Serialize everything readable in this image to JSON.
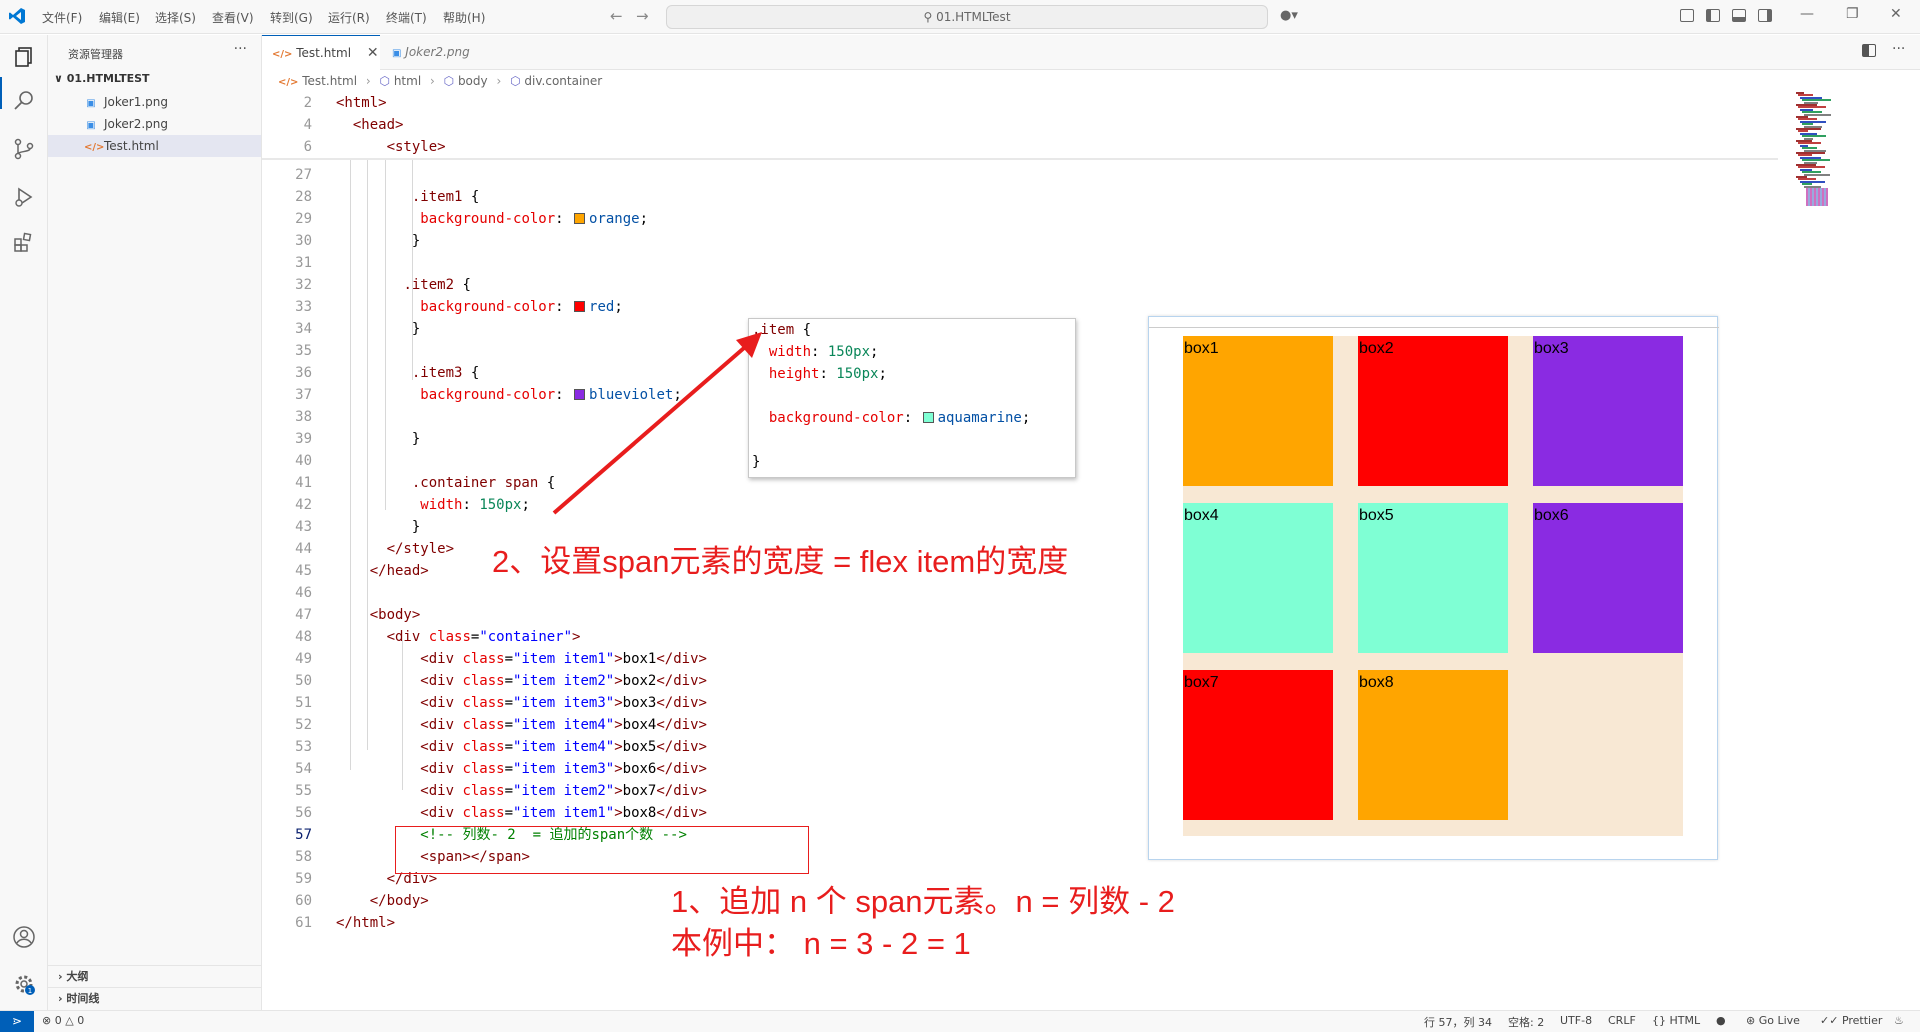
{
  "menu": [
    "文件(F)",
    "编辑(E)",
    "选择(S)",
    "查看(V)",
    "转到(G)",
    "运行(R)",
    "终端(T)",
    "帮助(H)"
  ],
  "search_text": "01.HTMLTest",
  "sidebar": {
    "title": "资源管理器",
    "folder": "01.HTMLTEST",
    "files": [
      "Joker1.png",
      "Joker2.png",
      "Test.html"
    ],
    "outline": "大纲",
    "timeline": "时间线"
  },
  "tabs": [
    {
      "label": "Test.html",
      "active": true
    },
    {
      "label": "Joker2.png",
      "active": false
    }
  ],
  "breadcrumb": [
    "Test.html",
    "html",
    "body",
    "div.container"
  ],
  "code_lines": [
    {
      "n": "2",
      "segs": [
        {
          "c": "tag",
          "t": "<html>"
        }
      ]
    },
    {
      "n": "4",
      "segs": [
        {
          "c": "txt",
          "t": "  "
        },
        {
          "c": "tag",
          "t": "<head>"
        }
      ]
    },
    {
      "n": "6",
      "segs": [
        {
          "c": "txt",
          "t": "      "
        },
        {
          "c": "tag",
          "t": "<style>"
        }
      ]
    },
    {
      "n": "27",
      "segs": []
    },
    {
      "n": "28",
      "segs": [
        {
          "c": "txt",
          "t": "         "
        },
        {
          "c": "sel",
          "t": ".item1"
        },
        {
          "c": "punc",
          "t": " {"
        }
      ]
    },
    {
      "n": "29",
      "segs": [
        {
          "c": "txt",
          "t": "          "
        },
        {
          "c": "prop",
          "t": "background-color"
        },
        {
          "c": "punc",
          "t": ": "
        },
        {
          "c": "swatch",
          "t": "#ffa500"
        },
        {
          "c": "val",
          "t": "orange"
        },
        {
          "c": "punc",
          "t": ";"
        }
      ]
    },
    {
      "n": "30",
      "segs": [
        {
          "c": "txt",
          "t": "         "
        },
        {
          "c": "punc",
          "t": "}"
        }
      ]
    },
    {
      "n": "31",
      "segs": []
    },
    {
      "n": "32",
      "segs": [
        {
          "c": "txt",
          "t": "        "
        },
        {
          "c": "sel",
          "t": ".item2"
        },
        {
          "c": "punc",
          "t": " {"
        }
      ]
    },
    {
      "n": "33",
      "segs": [
        {
          "c": "txt",
          "t": "          "
        },
        {
          "c": "prop",
          "t": "background-color"
        },
        {
          "c": "punc",
          "t": ": "
        },
        {
          "c": "swatch",
          "t": "#ff0000"
        },
        {
          "c": "val",
          "t": "red"
        },
        {
          "c": "punc",
          "t": ";"
        }
      ]
    },
    {
      "n": "34",
      "segs": [
        {
          "c": "txt",
          "t": "         "
        },
        {
          "c": "punc",
          "t": "}"
        }
      ]
    },
    {
      "n": "35",
      "segs": []
    },
    {
      "n": "36",
      "segs": [
        {
          "c": "txt",
          "t": "         "
        },
        {
          "c": "sel",
          "t": ".item3"
        },
        {
          "c": "punc",
          "t": " {"
        }
      ]
    },
    {
      "n": "37",
      "segs": [
        {
          "c": "txt",
          "t": "          "
        },
        {
          "c": "prop",
          "t": "background-color"
        },
        {
          "c": "punc",
          "t": ": "
        },
        {
          "c": "swatch",
          "t": "#8a2be2"
        },
        {
          "c": "val",
          "t": "blueviolet"
        },
        {
          "c": "punc",
          "t": ";"
        }
      ]
    },
    {
      "n": "38",
      "segs": []
    },
    {
      "n": "39",
      "segs": [
        {
          "c": "txt",
          "t": "         "
        },
        {
          "c": "punc",
          "t": "}"
        }
      ]
    },
    {
      "n": "40",
      "segs": []
    },
    {
      "n": "41",
      "segs": [
        {
          "c": "txt",
          "t": "         "
        },
        {
          "c": "sel",
          "t": ".container span"
        },
        {
          "c": "punc",
          "t": " {"
        }
      ]
    },
    {
      "n": "42",
      "segs": [
        {
          "c": "txt",
          "t": "          "
        },
        {
          "c": "prop",
          "t": "width"
        },
        {
          "c": "punc",
          "t": ": "
        },
        {
          "c": "num",
          "t": "150px"
        },
        {
          "c": "punc",
          "t": ";"
        }
      ]
    },
    {
      "n": "43",
      "segs": [
        {
          "c": "txt",
          "t": "         "
        },
        {
          "c": "punc",
          "t": "}"
        }
      ]
    },
    {
      "n": "44",
      "segs": [
        {
          "c": "txt",
          "t": "      "
        },
        {
          "c": "tag",
          "t": "</style>"
        }
      ]
    },
    {
      "n": "45",
      "segs": [
        {
          "c": "txt",
          "t": "    "
        },
        {
          "c": "tag",
          "t": "</head>"
        }
      ]
    },
    {
      "n": "46",
      "segs": []
    },
    {
      "n": "47",
      "segs": [
        {
          "c": "txt",
          "t": "    "
        },
        {
          "c": "tag",
          "t": "<body>"
        }
      ]
    },
    {
      "n": "48",
      "segs": [
        {
          "c": "txt",
          "t": "      "
        },
        {
          "c": "tag",
          "t": "<div"
        },
        {
          "c": "txt",
          "t": " "
        },
        {
          "c": "attr",
          "t": "class"
        },
        {
          "c": "punc",
          "t": "="
        },
        {
          "c": "str",
          "t": "\"container\""
        },
        {
          "c": "tag",
          "t": ">"
        }
      ]
    },
    {
      "n": "49",
      "segs": [
        {
          "c": "txt",
          "t": "          "
        },
        {
          "c": "tag",
          "t": "<div"
        },
        {
          "c": "txt",
          "t": " "
        },
        {
          "c": "attr",
          "t": "class"
        },
        {
          "c": "punc",
          "t": "="
        },
        {
          "c": "str",
          "t": "\"item item1\""
        },
        {
          "c": "tag",
          "t": ">"
        },
        {
          "c": "txt",
          "t": "box1"
        },
        {
          "c": "tag",
          "t": "</div>"
        }
      ]
    },
    {
      "n": "50",
      "segs": [
        {
          "c": "txt",
          "t": "          "
        },
        {
          "c": "tag",
          "t": "<div"
        },
        {
          "c": "txt",
          "t": " "
        },
        {
          "c": "attr",
          "t": "class"
        },
        {
          "c": "punc",
          "t": "="
        },
        {
          "c": "str",
          "t": "\"item item2\""
        },
        {
          "c": "tag",
          "t": ">"
        },
        {
          "c": "txt",
          "t": "box2"
        },
        {
          "c": "tag",
          "t": "</div>"
        }
      ]
    },
    {
      "n": "51",
      "segs": [
        {
          "c": "txt",
          "t": "          "
        },
        {
          "c": "tag",
          "t": "<div"
        },
        {
          "c": "txt",
          "t": " "
        },
        {
          "c": "attr",
          "t": "class"
        },
        {
          "c": "punc",
          "t": "="
        },
        {
          "c": "str",
          "t": "\"item item3\""
        },
        {
          "c": "tag",
          "t": ">"
        },
        {
          "c": "txt",
          "t": "box3"
        },
        {
          "c": "tag",
          "t": "</div>"
        }
      ]
    },
    {
      "n": "52",
      "segs": [
        {
          "c": "txt",
          "t": "          "
        },
        {
          "c": "tag",
          "t": "<div"
        },
        {
          "c": "txt",
          "t": " "
        },
        {
          "c": "attr",
          "t": "class"
        },
        {
          "c": "punc",
          "t": "="
        },
        {
          "c": "str",
          "t": "\"item item4\""
        },
        {
          "c": "tag",
          "t": ">"
        },
        {
          "c": "txt",
          "t": "box4"
        },
        {
          "c": "tag",
          "t": "</div>"
        }
      ]
    },
    {
      "n": "53",
      "segs": [
        {
          "c": "txt",
          "t": "          "
        },
        {
          "c": "tag",
          "t": "<div"
        },
        {
          "c": "txt",
          "t": " "
        },
        {
          "c": "attr",
          "t": "class"
        },
        {
          "c": "punc",
          "t": "="
        },
        {
          "c": "str",
          "t": "\"item item4\""
        },
        {
          "c": "tag",
          "t": ">"
        },
        {
          "c": "txt",
          "t": "box5"
        },
        {
          "c": "tag",
          "t": "</div>"
        }
      ]
    },
    {
      "n": "54",
      "segs": [
        {
          "c": "txt",
          "t": "          "
        },
        {
          "c": "tag",
          "t": "<div"
        },
        {
          "c": "txt",
          "t": " "
        },
        {
          "c": "attr",
          "t": "class"
        },
        {
          "c": "punc",
          "t": "="
        },
        {
          "c": "str",
          "t": "\"item item3\""
        },
        {
          "c": "tag",
          "t": ">"
        },
        {
          "c": "txt",
          "t": "box6"
        },
        {
          "c": "tag",
          "t": "</div>"
        }
      ]
    },
    {
      "n": "55",
      "segs": [
        {
          "c": "txt",
          "t": "          "
        },
        {
          "c": "tag",
          "t": "<div"
        },
        {
          "c": "txt",
          "t": " "
        },
        {
          "c": "attr",
          "t": "class"
        },
        {
          "c": "punc",
          "t": "="
        },
        {
          "c": "str",
          "t": "\"item item2\""
        },
        {
          "c": "tag",
          "t": ">"
        },
        {
          "c": "txt",
          "t": "box7"
        },
        {
          "c": "tag",
          "t": "</div>"
        }
      ]
    },
    {
      "n": "56",
      "segs": [
        {
          "c": "txt",
          "t": "          "
        },
        {
          "c": "tag",
          "t": "<div"
        },
        {
          "c": "txt",
          "t": " "
        },
        {
          "c": "attr",
          "t": "class"
        },
        {
          "c": "punc",
          "t": "="
        },
        {
          "c": "str",
          "t": "\"item item1\""
        },
        {
          "c": "tag",
          "t": ">"
        },
        {
          "c": "txt",
          "t": "box8"
        },
        {
          "c": "tag",
          "t": "</div>"
        }
      ]
    },
    {
      "n": "57",
      "active": true,
      "segs": [
        {
          "c": "txt",
          "t": "          "
        },
        {
          "c": "com",
          "t": "<!-- 列数- 2  = 追加的span个数 -->"
        }
      ]
    },
    {
      "n": "58",
      "segs": [
        {
          "c": "txt",
          "t": "          "
        },
        {
          "c": "tag",
          "t": "<span></span>"
        }
      ]
    },
    {
      "n": "59",
      "segs": [
        {
          "c": "txt",
          "t": "      "
        },
        {
          "c": "tag",
          "t": "</div>"
        }
      ]
    },
    {
      "n": "60",
      "segs": [
        {
          "c": "txt",
          "t": "    "
        },
        {
          "c": "tag",
          "t": "</body>"
        }
      ]
    },
    {
      "n": "61",
      "segs": [
        {
          "c": "tag",
          "t": "</html>"
        }
      ]
    }
  ],
  "popup_lines": [
    [
      {
        "c": "sel",
        "t": ".item"
      },
      {
        "c": "punc",
        "t": " {"
      }
    ],
    [
      {
        "c": "txt",
        "t": "  "
      },
      {
        "c": "prop",
        "t": "width"
      },
      {
        "c": "punc",
        "t": ": "
      },
      {
        "c": "num",
        "t": "150px"
      },
      {
        "c": "punc",
        "t": ";"
      }
    ],
    [
      {
        "c": "txt",
        "t": "  "
      },
      {
        "c": "prop",
        "t": "height"
      },
      {
        "c": "punc",
        "t": ": "
      },
      {
        "c": "num",
        "t": "150px"
      },
      {
        "c": "punc",
        "t": ";"
      }
    ],
    [],
    [
      {
        "c": "txt",
        "t": "  "
      },
      {
        "c": "prop",
        "t": "background-color"
      },
      {
        "c": "punc",
        "t": ": "
      },
      {
        "c": "swatch",
        "t": "#7fffd4"
      },
      {
        "c": "val",
        "t": "aquamarine"
      },
      {
        "c": "punc",
        "t": ";"
      }
    ],
    [],
    [
      {
        "c": "punc",
        "t": "}"
      }
    ]
  ],
  "preview_boxes": [
    {
      "label": "box1",
      "color": "#ffa500"
    },
    {
      "label": "box2",
      "color": "#ff0000"
    },
    {
      "label": "box3",
      "color": "#8a2be2"
    },
    {
      "label": "box4",
      "color": "#7fffd4"
    },
    {
      "label": "box5",
      "color": "#7fffd4"
    },
    {
      "label": "box6",
      "color": "#8a2be2"
    },
    {
      "label": "box7",
      "color": "#ff0000"
    },
    {
      "label": "box8",
      "color": "#ffa500"
    }
  ],
  "annotations": {
    "note2": "2、设置span元素的宽度 = flex item的宽度",
    "note1_line1": "1、追加 n 个 span元素。n = 列数 - 2",
    "note1_line2": "本例中：  n = 3 - 2 = 1"
  },
  "status": {
    "errors": "0",
    "warnings": "0",
    "position": "行 57，列 34",
    "spaces": "空格: 2",
    "encoding": "UTF-8",
    "eol": "CRLF",
    "language": "HTML",
    "golive": "Go Live",
    "prettier": "Prettier"
  }
}
